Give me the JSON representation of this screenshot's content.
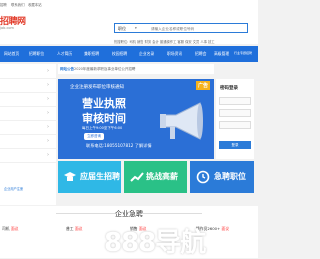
{
  "topbar": {
    "left": "招聘",
    "items": [
      "联系我们",
      "收藏本站"
    ]
  },
  "logo": {
    "name": "招聘网",
    "sub": "job.com"
  },
  "search": {
    "category": "职位",
    "caret": "▾",
    "placeholder": "请输入企业名称或职位号码"
  },
  "hotwords": "热搜职位: 司机 销售 财务 会计 普通操作工 客服 保安 文员 人事 技工",
  "nav": [
    "网站首页",
    "招聘职位",
    "人才简历",
    "兼职招聘",
    "校园招聘",
    "企业名录",
    "职场资讯",
    "招聘会",
    "高级管理",
    "行业专题招聘"
  ],
  "leftcol": {
    "link": "企业用户注册"
  },
  "notice": {
    "tag": "网站公告",
    "text": "2020年度最新求职及事业单位公开招聘"
  },
  "banner": {
    "top": "企业注册发布职位审核通知",
    "tag": "广告",
    "line1": "营业执照",
    "line2": "审核时间",
    "small": "每日上午9:00至下午6:00",
    "btn": "立即咨询",
    "bottom": "联系电话:18055107812 了解详情"
  },
  "login": {
    "title": "密码登录",
    "button": "登录"
  },
  "cards": [
    {
      "label": "应届生招聘",
      "color": "#2fb8e6"
    },
    {
      "label": "挑战高薪",
      "color": "#2ac187"
    },
    {
      "label": "急聘职位",
      "color": "#2b7bd8"
    }
  ],
  "section": {
    "title": "企业急聘",
    "jobs": [
      {
        "name": "司机",
        "salary": "面议"
      },
      {
        "name": "普工",
        "salary": "面议"
      },
      {
        "name": "销售",
        "salary": "面议"
      },
      {
        "name": "操作员2600+",
        "salary": "面议"
      }
    ]
  },
  "watermark": "888导航"
}
